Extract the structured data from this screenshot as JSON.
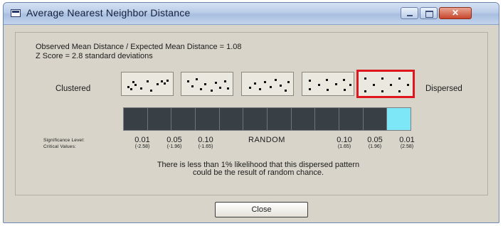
{
  "window": {
    "title": "Average Nearest Neighbor Distance",
    "controls": [
      "minimize-icon",
      "maximize-icon",
      "close-icon"
    ],
    "close_glyph": "✕"
  },
  "summary": {
    "ratio_line": "Observed Mean Distance / Expected Mean Distance = 1.08",
    "zscore_line": "Z Score = 2.8 standard deviations"
  },
  "pattern_scale": {
    "left_label": "Clustered",
    "right_label": "Dispersed",
    "thumbnail_count": 5,
    "selected_index": 4,
    "selected_color": "#e0161e"
  },
  "significance": {
    "bar_segments": 12,
    "active_segment": 11,
    "segment_color": "#384046",
    "active_color": "#7de7f7",
    "level_label": "Significance Level:",
    "critical_label": "Critical Values:",
    "levels": [
      "0.01",
      "0.05",
      "0.10",
      "0.10",
      "0.05",
      "0.01"
    ],
    "critical": [
      "(-2.58)",
      "(-1.96)",
      "(-1.65)",
      "(1.65)",
      "(1.96)",
      "(2.58)"
    ],
    "random_label": "RANDOM"
  },
  "message": {
    "line1": "There is less than 1% likelihood that this dispersed pattern",
    "line2": "could be the result of random chance."
  },
  "buttons": {
    "close_label": "Close"
  }
}
